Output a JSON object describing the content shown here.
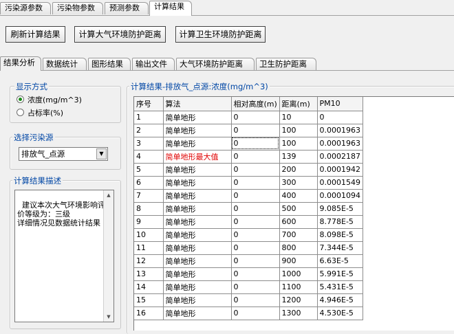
{
  "top_tabs": [
    "污染源参数",
    "污染物参数",
    "预测参数",
    "计算结果"
  ],
  "buttons": {
    "refresh": "刷新计算结果",
    "atmos": "计算大气环境防护距离",
    "sanitary": "计算卫生环境防护距离"
  },
  "sub_tabs": [
    "结果分析",
    "数据统计",
    "图形结果",
    "输出文件",
    "大气环境防护距离",
    "卫生防护距离"
  ],
  "display_mode": {
    "title": "显示方式",
    "options": [
      "浓度(mg/m^3)",
      "占标率(%)"
    ],
    "selected": 0
  },
  "source_select": {
    "title": "选择污染源",
    "value": "排放气_点源"
  },
  "description": {
    "title": "计算结果描述",
    "text": "建议本次大气环境影响评价等级为：三级\n详细情况见数据统计结果"
  },
  "result_table": {
    "title": "计算结果-排放气_点源:浓度(mg/m^3)",
    "columns": [
      "序号",
      "算法",
      "相对高度(m)",
      "距离(m)",
      "PM10"
    ],
    "rows": [
      [
        "1",
        "简单地形",
        "0",
        "10",
        "0"
      ],
      [
        "2",
        "简单地形",
        "0",
        "100",
        "0.0001963"
      ],
      [
        "3",
        "简单地形",
        "0",
        "100",
        "0.0001963"
      ],
      [
        "4",
        "简单地形最大值",
        "0",
        "139",
        "0.0002187"
      ],
      [
        "5",
        "简单地形",
        "0",
        "200",
        "0.0001942"
      ],
      [
        "6",
        "简单地形",
        "0",
        "300",
        "0.0001549"
      ],
      [
        "7",
        "简单地形",
        "0",
        "400",
        "0.0001094"
      ],
      [
        "8",
        "简单地形",
        "0",
        "500",
        "9.085E-5"
      ],
      [
        "9",
        "简单地形",
        "0",
        "600",
        "8.778E-5"
      ],
      [
        "10",
        "简单地形",
        "0",
        "700",
        "8.098E-5"
      ],
      [
        "11",
        "简单地形",
        "0",
        "800",
        "7.344E-5"
      ],
      [
        "12",
        "简单地形",
        "0",
        "900",
        "6.63E-5"
      ],
      [
        "13",
        "简单地形",
        "0",
        "1000",
        "5.991E-5"
      ],
      [
        "14",
        "简单地形",
        "0",
        "1100",
        "5.431E-5"
      ],
      [
        "15",
        "简单地形",
        "0",
        "1200",
        "4.946E-5"
      ],
      [
        "16",
        "简单地形",
        "0",
        "1300",
        "4.530E-5"
      ]
    ],
    "highlight_row": 3,
    "highlight_color": "#e00000"
  }
}
